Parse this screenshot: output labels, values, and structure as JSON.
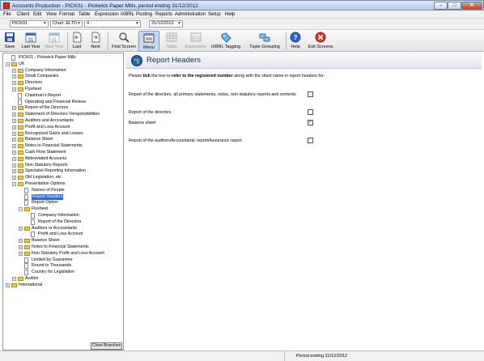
{
  "window": {
    "title": "Accounts Production - PICK01 - Pickwick Paper Mills, period ending 31/12/2012",
    "minimize": "–",
    "maximize": "□",
    "close": "✕"
  },
  "menu": [
    "File",
    "Client",
    "Edit",
    "View",
    "Format",
    "Table",
    "Expression",
    "iXBRL",
    "Posting",
    "Reports",
    "Administration",
    "Setup",
    "Help"
  ],
  "selectors": {
    "client": "PICK01",
    "chart": "Chart: ELTD",
    "chart_extra": "4 -",
    "period": "31/12/2012"
  },
  "toolbar": {
    "save": "Save",
    "last_year": "Last Year",
    "next_year": "Next Year",
    "last": "Last",
    "next": "Next",
    "find_screen": "Find Screen",
    "menu": "Menu",
    "table": "Table",
    "expression": "Expression",
    "ixbrl_tagging": "iXBRL Tagging",
    "tuple_grouping": "Tuple Grouping",
    "help": "Help",
    "exit_screens": "Exit Screens"
  },
  "tree": [
    {
      "label": "PICK01 - Pickwick Paper Mills",
      "level": 0,
      "type": "root",
      "toggle": ""
    },
    {
      "label": "UK",
      "level": 0,
      "type": "folder",
      "toggle": "−"
    },
    {
      "label": "Company Information",
      "level": 1,
      "type": "folder",
      "toggle": "+"
    },
    {
      "label": "Small Companies",
      "level": 1,
      "type": "folder",
      "toggle": "+"
    },
    {
      "label": "Directors",
      "level": 1,
      "type": "folder",
      "toggle": "+"
    },
    {
      "label": "Flysheet",
      "level": 1,
      "type": "folder",
      "toggle": "+"
    },
    {
      "label": "Chairman's Report",
      "level": 1,
      "type": "page",
      "toggle": ""
    },
    {
      "label": "Operating and Financial Review",
      "level": 1,
      "type": "page",
      "toggle": ""
    },
    {
      "label": "Report of the Directors",
      "level": 1,
      "type": "folder",
      "toggle": "+"
    },
    {
      "label": "Statement of Directors' Responsibilities",
      "level": 1,
      "type": "folder",
      "toggle": "+"
    },
    {
      "label": "Auditors and Accountants",
      "level": 1,
      "type": "folder",
      "toggle": "+"
    },
    {
      "label": "Profit and Loss Account",
      "level": 1,
      "type": "folder",
      "toggle": "+"
    },
    {
      "label": "Recognised Gains and Losses",
      "level": 1,
      "type": "folder",
      "toggle": "+"
    },
    {
      "label": "Balance Sheet",
      "level": 1,
      "type": "folder",
      "toggle": "+"
    },
    {
      "label": "Notes to Financial Statements",
      "level": 1,
      "type": "folder",
      "toggle": "+"
    },
    {
      "label": "Cash Flow Statement",
      "level": 1,
      "type": "folder",
      "toggle": "+"
    },
    {
      "label": "Abbreviated Accounts",
      "level": 1,
      "type": "folder",
      "toggle": "+"
    },
    {
      "label": "Non-Statutory Reports",
      "level": 1,
      "type": "folder",
      "toggle": "+"
    },
    {
      "label": "Specialist Reporting Information",
      "level": 1,
      "type": "folder",
      "toggle": "+"
    },
    {
      "label": "Old Legislation, etc",
      "level": 1,
      "type": "folder",
      "toggle": "+"
    },
    {
      "label": "Presentation Options",
      "level": 1,
      "type": "folder",
      "toggle": "−"
    },
    {
      "label": "Names of People",
      "level": 2,
      "type": "page",
      "toggle": ""
    },
    {
      "label": "Report Headers",
      "level": 2,
      "type": "page",
      "toggle": "",
      "selected": true
    },
    {
      "label": "Report Option",
      "level": 2,
      "type": "page",
      "toggle": ""
    },
    {
      "label": "Flysheet",
      "level": 2,
      "type": "folder",
      "toggle": "−"
    },
    {
      "label": "Company Information",
      "level": 3,
      "type": "page",
      "toggle": ""
    },
    {
      "label": "Report of the Directors",
      "level": 3,
      "type": "page",
      "toggle": ""
    },
    {
      "label": "Auditors or Accountants",
      "level": 2,
      "type": "folder",
      "toggle": "+"
    },
    {
      "label": "Profit and Loss Account",
      "level": 3,
      "type": "page",
      "toggle": ""
    },
    {
      "label": "Balance Sheet",
      "level": 2,
      "type": "folder",
      "toggle": "+"
    },
    {
      "label": "Notes to Financial Statements",
      "level": 2,
      "type": "folder",
      "toggle": "+"
    },
    {
      "label": "Non-Statutory Profit and Loss Account",
      "level": 2,
      "type": "folder",
      "toggle": "+"
    },
    {
      "label": "Limited by Guarantee",
      "level": 2,
      "type": "page",
      "toggle": ""
    },
    {
      "label": "Round to Thousands",
      "level": 2,
      "type": "page",
      "toggle": ""
    },
    {
      "label": "Country for Legislation",
      "level": 2,
      "type": "page",
      "toggle": ""
    },
    {
      "label": "Auditor",
      "level": 1,
      "type": "folder",
      "toggle": "+"
    },
    {
      "label": "International",
      "level": 0,
      "type": "folder",
      "toggle": "+"
    }
  ],
  "close_branches": "Close Branches",
  "panel": {
    "title": "Report Headers",
    "instruction_pre": "Please ",
    "instruction_b1": "tick",
    "instruction_mid": " the box to ",
    "instruction_b2": "refer to the registered number",
    "instruction_post": " along with the client name in report headers for:",
    "options": [
      {
        "label": "Report of the directors, all primary statements, notes, non-statutory reports and contents",
        "checked": false
      },
      {
        "label": "Report of the directors",
        "checked": false
      },
      {
        "label": "Balance sheet",
        "checked": true
      },
      {
        "label": "Report of the auditors/Accountants' report/Assurance report",
        "checked": false
      }
    ]
  },
  "status": {
    "period": "Period ending 31/12/2012"
  }
}
